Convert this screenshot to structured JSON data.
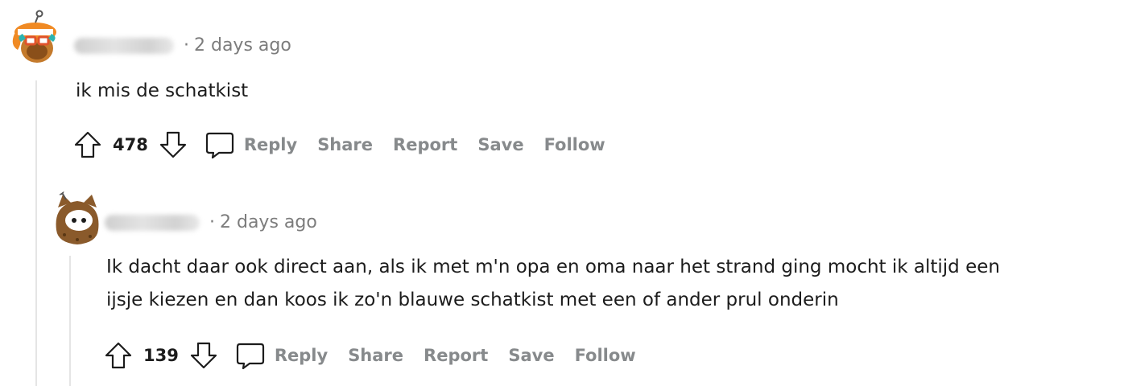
{
  "comments": [
    {
      "username": "beansaus987",
      "timestamp": "2 days ago",
      "body": [
        "ik mis de schatkist"
      ],
      "score": "478",
      "actions": {
        "reply": "Reply",
        "share": "Share",
        "report": "Report",
        "save": "Save",
        "follow": "Follow"
      },
      "avatar": "snoo-avatar-orange-hat"
    },
    {
      "username": "missthart23",
      "timestamp": "2 days ago",
      "body": [
        "Ik dacht daar ook direct aan, als ik met m'n opa en oma naar het strand ging mocht ik altijd een",
        "ijsje kiezen en dan koos ik zo'n blauwe schatkist met een of ander prul onderin"
      ],
      "score": "139",
      "actions": {
        "reply": "Reply",
        "share": "Share",
        "report": "Report",
        "save": "Save",
        "follow": "Follow"
      },
      "avatar": "snoo-avatar-brown-hood"
    }
  ],
  "colors": {
    "meta_text": "#7c7c7c",
    "action_text": "#878a8c",
    "thread_line": "#e5e5e5",
    "body_text": "#1c1c1c"
  }
}
